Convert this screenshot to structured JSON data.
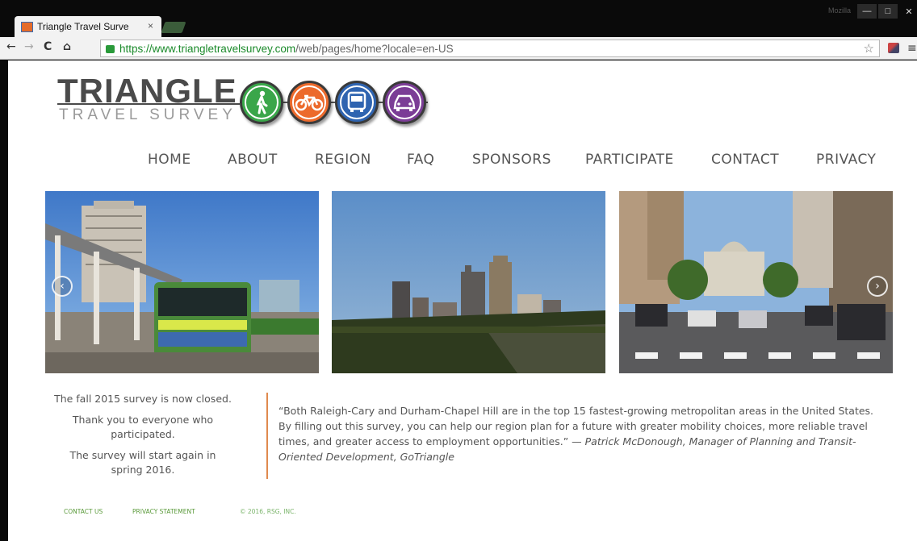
{
  "browser": {
    "tab_title": "Triangle Travel Surve",
    "tab_close": "×",
    "url_scheme": "https://",
    "url_host": "www.triangletravelsurvey.com",
    "url_path": "/web/pages/home?locale=en-US",
    "window_user": "Mozilla",
    "icons": [
      "back-icon",
      "forward-icon",
      "reload-icon",
      "home-icon",
      "lock-icon",
      "star-icon",
      "extension-icon",
      "menu-icon"
    ]
  },
  "logo": {
    "title": "TRIANGLE",
    "subtitle": "TRAVEL SURVEY",
    "modes": [
      {
        "name": "walk",
        "color": "#3aa64a"
      },
      {
        "name": "bike",
        "color": "#ec6a2c"
      },
      {
        "name": "bus",
        "color": "#2f64b0"
      },
      {
        "name": "car",
        "color": "#7b3d96"
      }
    ]
  },
  "nav": [
    "HOME",
    "ABOUT",
    "REGION",
    "FAQ",
    "SPONSORS",
    "PARTICIPATE",
    "CONTACT",
    "PRIVACY"
  ],
  "carousel": {
    "photos": [
      "bus-station-photo",
      "city-skyline-photo",
      "downtown-street-photo"
    ],
    "prev_icon": "‹",
    "next_icon": "›"
  },
  "status": {
    "line1": "The fall 2015 survey is now closed.",
    "line2": "Thank you to everyone who participated.",
    "line3": "The survey will start again in spring 2016."
  },
  "quote": {
    "text": "“Both Raleigh-Cary and Durham-Chapel Hill are in the top 15 fastest-growing metropolitan areas in the United States. By filling out this survey, you can help our region plan for a future with greater mobility choices, more reliable travel times, and greater access to employment opportunities.” — ",
    "attribution": "Patrick McDonough, Manager of Planning and Transit-Oriented Development, GoTriangle"
  },
  "footer": {
    "contact": "CONTACT US",
    "privacy": "PRIVACY STATEMENT",
    "copyright": "© 2016, RSG, INC."
  },
  "colors": {
    "accent_orange": "#e08a4e",
    "footer_green": "#5a9a3a",
    "url_green": "#1a8a2a"
  }
}
